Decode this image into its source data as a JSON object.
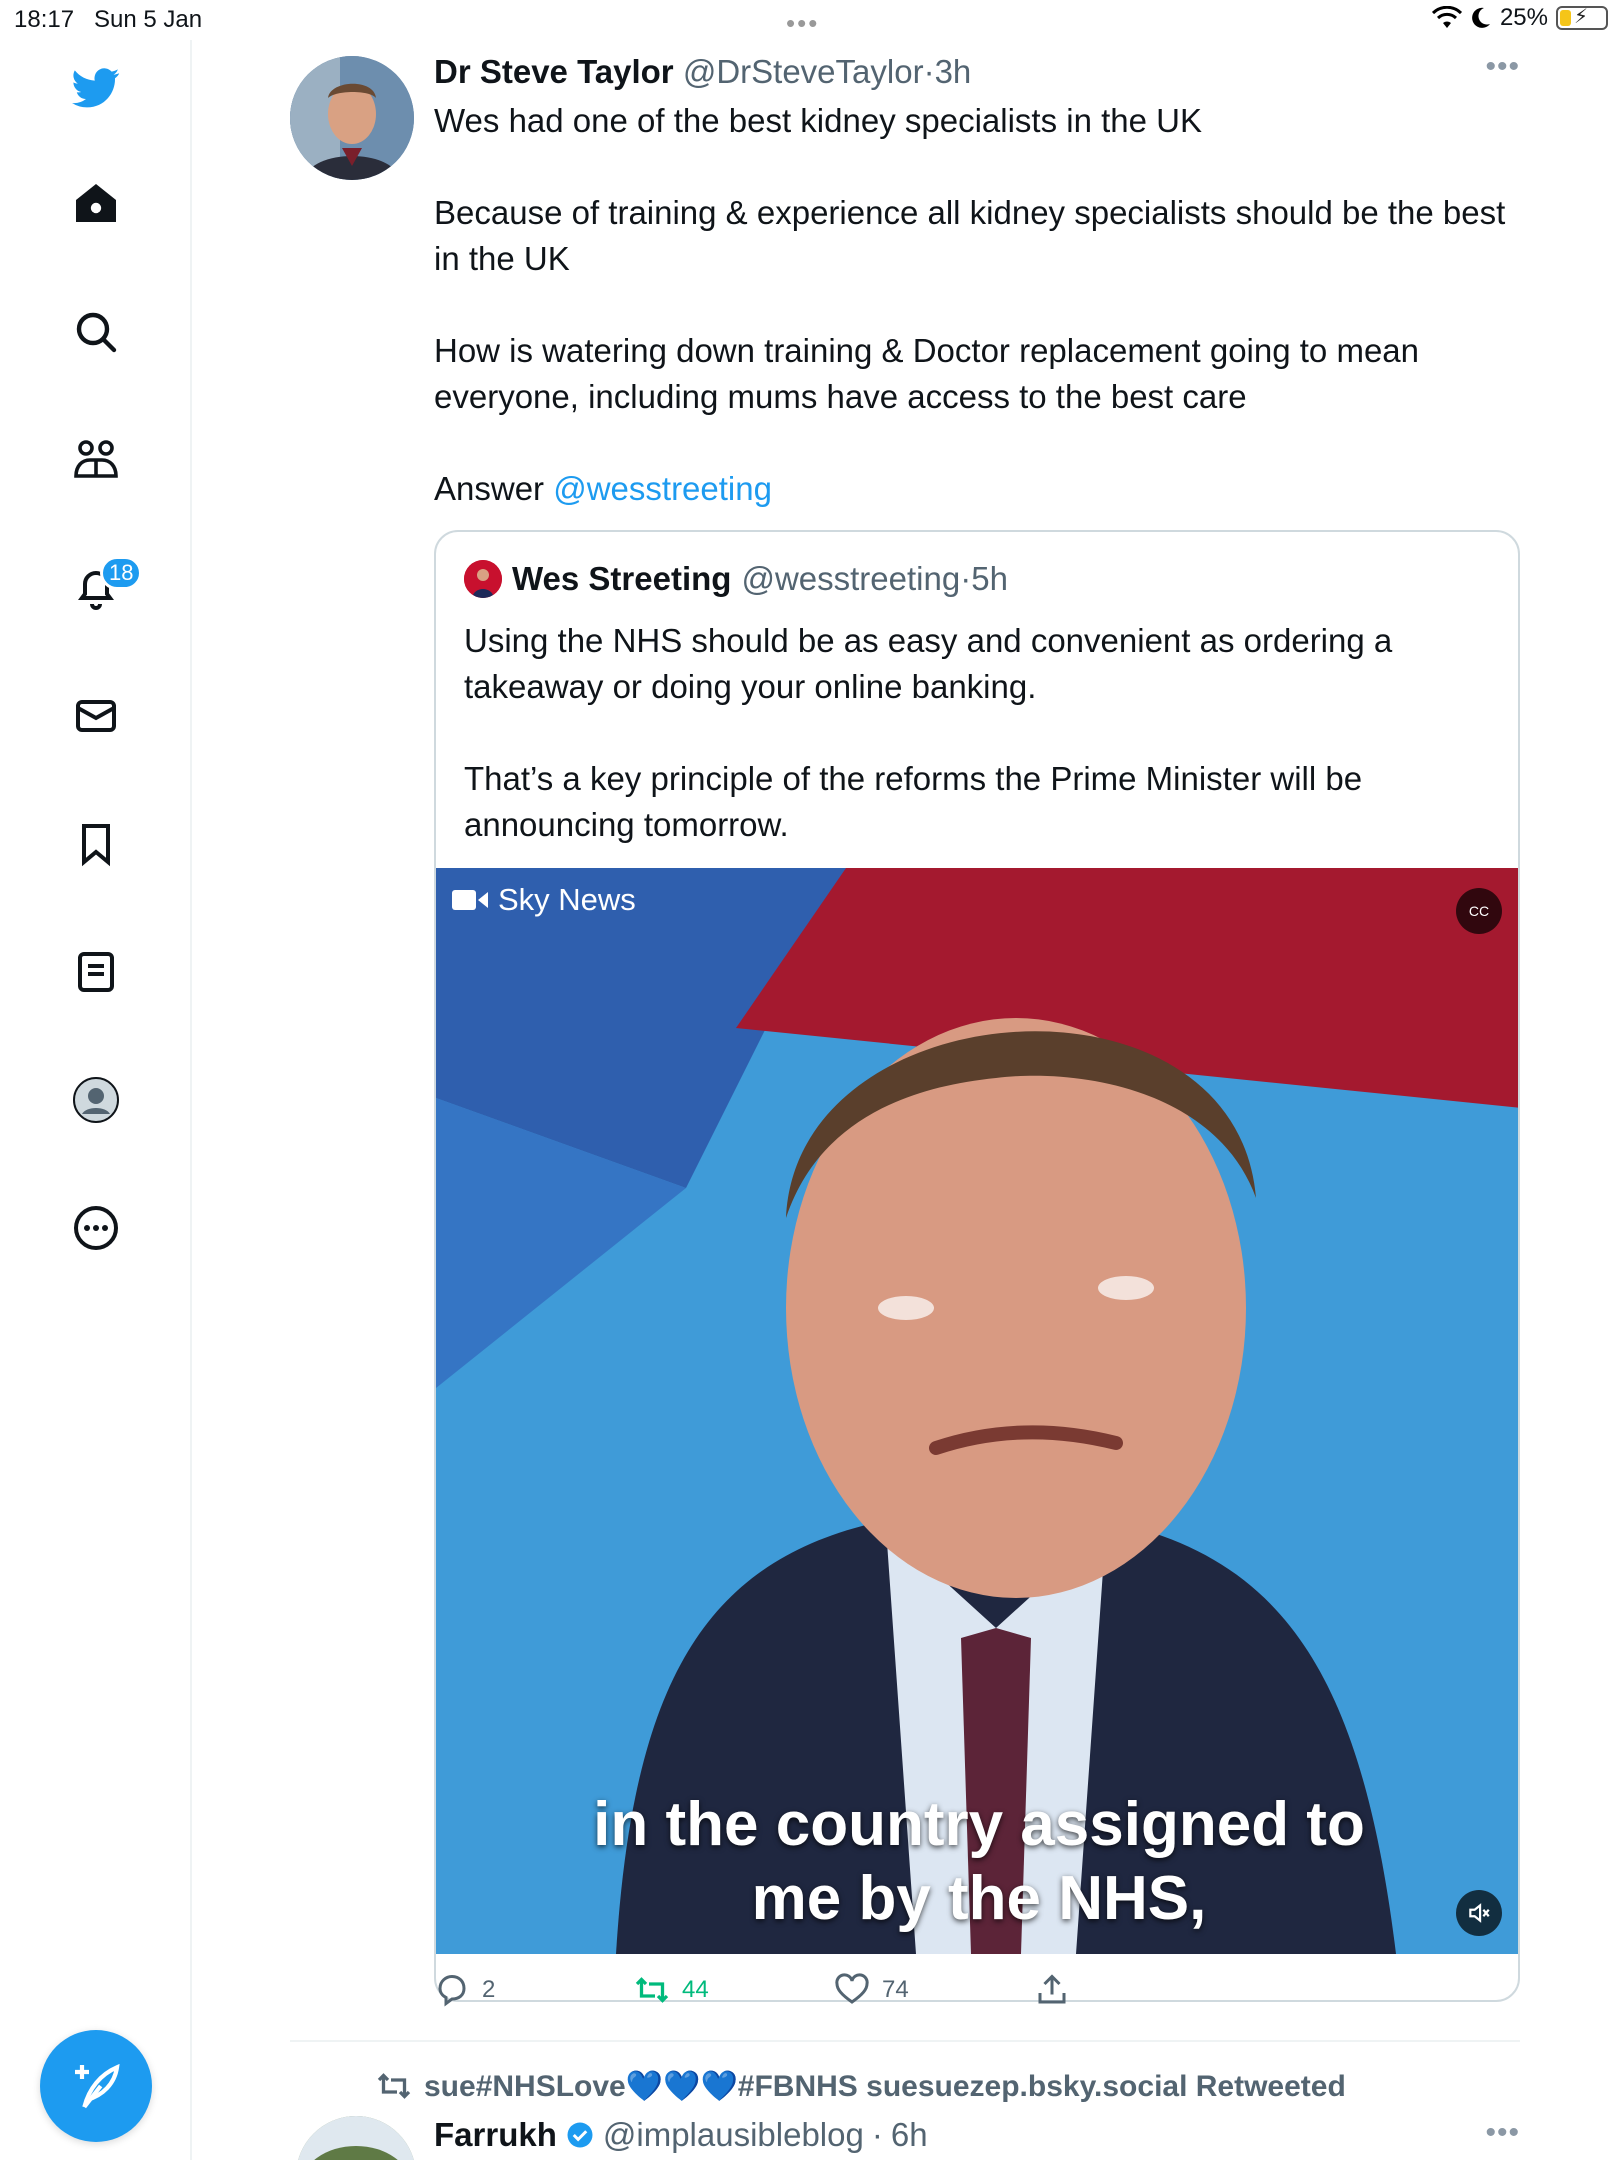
{
  "status_bar": {
    "time": "18:17",
    "date": "Sun 5 Jan",
    "battery": "25%",
    "battery_level": 0.25
  },
  "sidebar": {
    "items": [
      {
        "icon": "twitter-bird-icon"
      },
      {
        "icon": "home-icon"
      },
      {
        "icon": "search-icon"
      },
      {
        "icon": "communities-icon"
      },
      {
        "icon": "notifications-bell-icon",
        "badge": "18"
      },
      {
        "icon": "messages-envelope-icon"
      },
      {
        "icon": "bookmark-icon"
      },
      {
        "icon": "lists-icon"
      },
      {
        "icon": "profile-avatar-icon"
      },
      {
        "icon": "more-circle-icon"
      }
    ],
    "compose_icon": "compose-feather-icon"
  },
  "colors": {
    "accent": "#1d9bf0",
    "text": "#0f1419",
    "muted": "#536471",
    "retweet": "#00ba7c"
  },
  "tweet": {
    "author_name": "Dr Steve Taylor",
    "author_handle": "@DrSteveTaylor",
    "time": "3h",
    "separator": "·",
    "text": "Wes had one of the best kidney specialists in the UK\n\nBecause of training & experience all kidney specialists should be the best in the UK\n\nHow is watering down training & Doctor replacement going to mean everyone, including mums have access to the best care\n\nAnswer ",
    "mention": "@wesstreeting",
    "quote": {
      "author_name": "Wes Streeting",
      "author_handle": "@wesstreeting",
      "time": "5h",
      "text": "Using the NHS should be as easy and convenient as ordering a takeaway or doing your online banking.\n\nThat’s a key principle of the reforms the Prime Minister will be announcing tomorrow.",
      "video": {
        "source_label": "Sky News",
        "cc_label": "CC",
        "caption": "in the country assigned to\nme by the NHS,"
      }
    },
    "actions": {
      "replies": "2",
      "retweets": "44",
      "likes": "74"
    }
  },
  "next": {
    "retweeted_by": "sue#NHSLove💙💙💙#FBNHS suesuezep.bsky.social Retweeted",
    "author_name": "Farrukh",
    "author_handle": "@implausibleblog",
    "time": "6h",
    "separator": "·"
  }
}
